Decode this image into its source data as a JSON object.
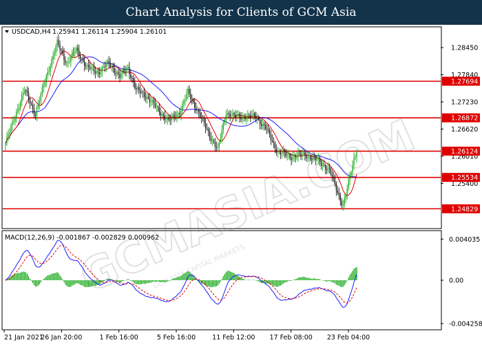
{
  "header": {
    "title": "Chart Analysis for Clients of GCM Asia"
  },
  "watermark": {
    "text": "GCMASIA.COM",
    "subtext": "GCM ASIA CAPITAL MARKETS"
  },
  "chart_data": [
    {
      "type": "candlestick",
      "symbol_label": "USDCAD,H4",
      "ohlc_readout": "1.25941 1.26114 1.25904 1.26101",
      "ylim": [
        1.244,
        1.289
      ],
      "y_ticks": [
        1.2845,
        1.2784,
        1.2723,
        1.2662,
        1.2601,
        1.254
      ],
      "y_tick_labels": [
        "1.28450",
        "1.27840",
        "1.27230",
        "1.26620",
        "1.26010",
        "1.25400"
      ],
      "x_tick_labels": [
        "21 Jan 2021",
        "26 Jan 20:00",
        "1 Feb 16:00",
        "5 Feb 16:00",
        "11 Feb 12:00",
        "17 Feb 08:00",
        "23 Feb 04:00"
      ],
      "levels": [
        1.27694,
        1.26872,
        1.26124,
        1.25534,
        1.24829
      ],
      "level_labels": [
        "1.27694",
        "1.26872",
        "1.26124",
        "1.25534",
        "1.24829"
      ],
      "level_color": "#e00000",
      "current_price": 1.26101,
      "anchors": [
        [
          0,
          1.263
        ],
        [
          8,
          1.27
        ],
        [
          14,
          1.275
        ],
        [
          22,
          1.2695
        ],
        [
          30,
          1.278
        ],
        [
          38,
          1.2855
        ],
        [
          45,
          1.281
        ],
        [
          52,
          1.284
        ],
        [
          60,
          1.28
        ],
        [
          68,
          1.279
        ],
        [
          76,
          1.281
        ],
        [
          84,
          1.278
        ],
        [
          90,
          1.28
        ],
        [
          96,
          1.275
        ],
        [
          104,
          1.2735
        ],
        [
          112,
          1.2705
        ],
        [
          120,
          1.268
        ],
        [
          128,
          1.27
        ],
        [
          134,
          1.2745
        ],
        [
          140,
          1.271
        ],
        [
          148,
          1.266
        ],
        [
          156,
          1.2615
        ],
        [
          162,
          1.27
        ],
        [
          168,
          1.269
        ],
        [
          176,
          1.269
        ],
        [
          184,
          1.269
        ],
        [
          192,
          1.266
        ],
        [
          200,
          1.261
        ],
        [
          210,
          1.26
        ],
        [
          220,
          1.2605
        ],
        [
          230,
          1.259
        ],
        [
          238,
          1.257
        ],
        [
          244,
          1.252
        ],
        [
          248,
          1.249
        ],
        [
          252,
          1.254
        ],
        [
          256,
          1.2595
        ],
        [
          258,
          1.26101
        ]
      ],
      "colors": {
        "bull": "#00a000",
        "bear": "#000000",
        "ma_fast": "#e00000",
        "ma_slow": "#1a1aff"
      }
    },
    {
      "type": "macd",
      "label": "MACD(12,26,9) -0.001867 -0.002829 0.000962",
      "ylim": [
        -0.0048,
        0.0048
      ],
      "y_ticks": [
        0.004035,
        0.0,
        -0.004258
      ],
      "y_tick_labels": [
        "0.004035",
        "0.00",
        "-0.004258"
      ],
      "colors": {
        "histogram": "#00a000",
        "macd": "#1a1aff",
        "signal": "#e00000"
      }
    }
  ]
}
